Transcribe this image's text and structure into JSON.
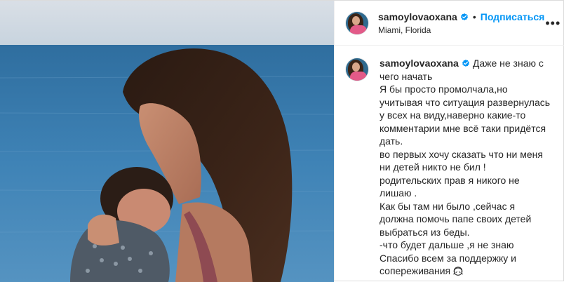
{
  "post": {
    "username": "samoylovaoxana",
    "follow_label": "Подписаться",
    "separator": "•",
    "location": "Miami, Florida",
    "more_label": "•••",
    "caption": {
      "username": "samoylovaoxana",
      "first_line_text": "Даже не знаю с",
      "lines": [
        "чего начать",
        "Я бы просто промолчала,но",
        "учитывая что ситуация развернулась",
        "у всех на виду,наверно какие-то",
        "комментарии мне всё таки придётся",
        "дать.",
        "во первых хочу сказать что ни меня",
        "ни детей никто не бил !",
        "родительских прав я никого не",
        "лишаю .",
        "Как бы там ни было ,сейчас я",
        "должна помочь папе своих детей",
        "выбраться из беды.",
        "-что будет дальше ,я не знаю",
        "Спасибо всем за поддержку и",
        "сопереживания"
      ]
    }
  },
  "colors": {
    "accent": "#0095f6",
    "text": "#262626",
    "border": "#dbdbdb"
  },
  "icons": {
    "verified": "verified-badge-icon",
    "more": "more-options-icon",
    "emoji": "emoji-icon"
  }
}
